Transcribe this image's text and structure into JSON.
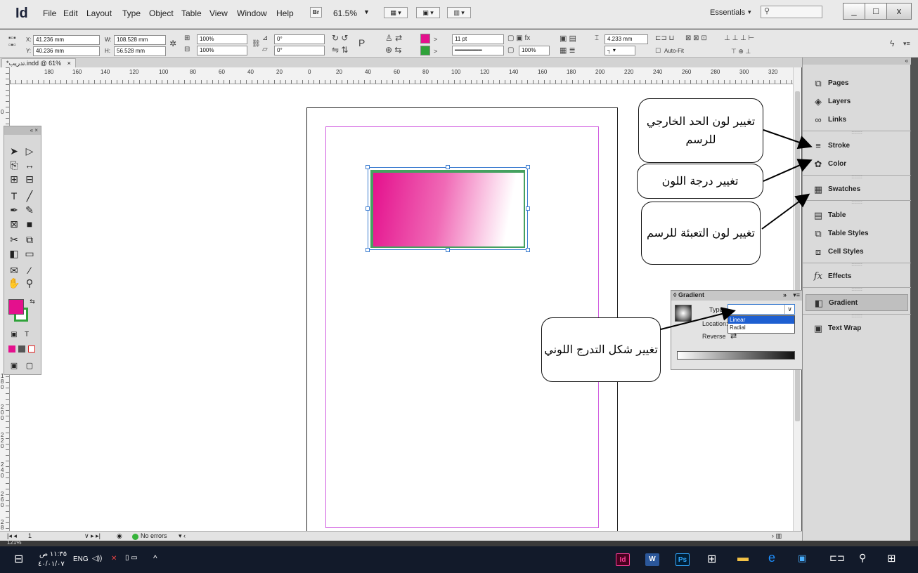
{
  "app": {
    "logo": "Id",
    "menus": [
      "File",
      "Edit",
      "Layout",
      "Type",
      "Object",
      "Table",
      "View",
      "Window",
      "Help"
    ],
    "bridge_label": "Br",
    "zoom": "61.5%",
    "workspace": "Essentials",
    "search_placeholder": "",
    "window_buttons": [
      "_",
      "□",
      "x"
    ]
  },
  "control": {
    "x_label": "X:",
    "x_value": "41.236 mm",
    "y_label": "Y:",
    "y_value": "40.236 mm",
    "w_label": "W:",
    "w_value": "108.528 mm",
    "h_label": "H:",
    "h_value": "56.528 mm",
    "scale_x": "100%",
    "scale_y": "100%",
    "angle1": "0°",
    "angle2": "0°",
    "stroke_weight": "11 pt",
    "opacity": "100%",
    "offset": "4.233 mm",
    "autofit": "Auto-Fit",
    "fill_color": "#e4108d",
    "stroke_color": "#2fa23a"
  },
  "document": {
    "tab_title": "*تدريب.indd @ 61%",
    "tab_close": "×",
    "ruler_labels": [
      "180",
      "160",
      "140",
      "120",
      "100",
      "80",
      "60",
      "40",
      "20",
      "0",
      "20",
      "40",
      "60",
      "80",
      "100",
      "120",
      "140",
      "160",
      "180",
      "200",
      "220",
      "240",
      "260",
      "280",
      "300",
      "320"
    ],
    "vruler_labels": [
      "0",
      "180",
      "200",
      "220",
      "240",
      "260",
      "280"
    ]
  },
  "tools": {
    "head": "«  ×"
  },
  "status": {
    "page": "1",
    "preflight": "No errors",
    "zoom_bottom": "121%"
  },
  "dock": {
    "items": [
      {
        "label": "Pages",
        "icon": "pages-icon"
      },
      {
        "label": "Layers",
        "icon": "layers-icon"
      },
      {
        "label": "Links",
        "icon": "links-icon"
      },
      {
        "label": "Stroke",
        "icon": "stroke-icon"
      },
      {
        "label": "Color",
        "icon": "color-icon"
      },
      {
        "label": "Swatches",
        "icon": "swatches-icon"
      },
      {
        "label": "Table",
        "icon": "table-icon"
      },
      {
        "label": "Table Styles",
        "icon": "table-styles-icon"
      },
      {
        "label": "Cell Styles",
        "icon": "cell-styles-icon"
      },
      {
        "label": "Effects",
        "icon": "effects-icon"
      },
      {
        "label": "Gradient",
        "icon": "gradient-icon"
      },
      {
        "label": "Text Wrap",
        "icon": "text-wrap-icon"
      }
    ]
  },
  "gradient_panel": {
    "title": "Gradient",
    "type_label": "Type:",
    "location_label": "Location:",
    "reverse_label": "Reverse",
    "options": [
      "Linear",
      "Radial"
    ],
    "selected_option": "Linear"
  },
  "callouts": {
    "stroke": "تغيير لون الحد الخارجي للرسم",
    "color": "تغيير درجة اللون",
    "swatches": "تغيير لون التعبئة للرسم",
    "gradient": "تغيير شكل التدرج اللوني"
  },
  "taskbar": {
    "time": "١١:٣٥ ص",
    "date": "٤٠/٠١/٠٧",
    "lang": "ENG",
    "apps": [
      "Id",
      "W",
      "Ps"
    ]
  }
}
